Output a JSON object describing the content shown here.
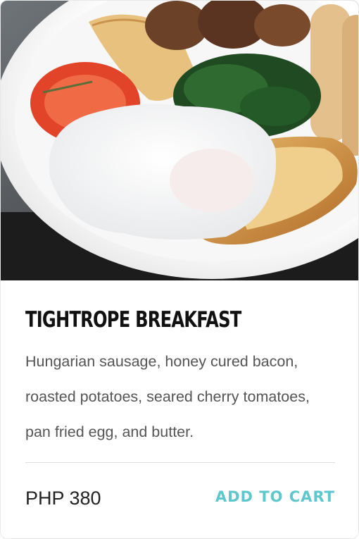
{
  "product": {
    "image_alt": "breakfast plate photo",
    "title": "TIGHTROPE BREAKFAST",
    "description": "Hungarian sausage, honey cured bacon, roasted potatoes, seared cherry tomatoes, pan fried  egg, and butter.",
    "price": "PHP 380"
  },
  "actions": {
    "add_to_cart_label": "ADD TO CART"
  },
  "colors": {
    "accent": "#5cc7cc",
    "title": "#111111",
    "text": "#555555",
    "divider": "#dddddd"
  }
}
